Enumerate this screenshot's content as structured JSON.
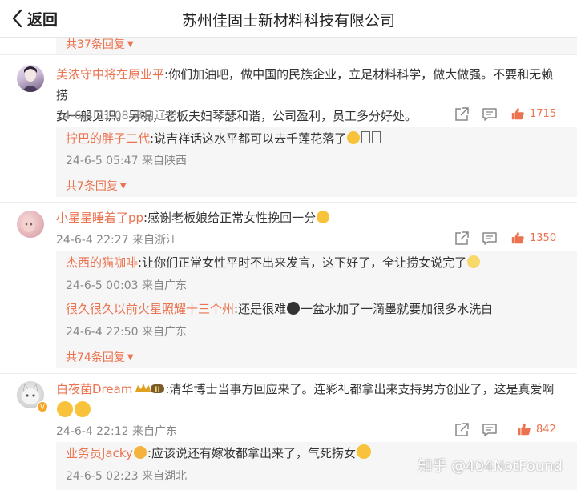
{
  "header": {
    "back_label": "返回",
    "title": "苏州佳固士新材料科技有限公司"
  },
  "top_more": "共37条回复",
  "comments": [
    {
      "user": "美浓守中将在原业平",
      "text1": ":你们加油吧，做中国的民族企业，立足材料科学，做大做强。不要和无赖捞",
      "text2": "女一般见识。另祝，老板夫妇琴瑟和谐，公司盈利，员工多分好处。",
      "time": "24-6-4 21:08",
      "location": "来自辽宁",
      "likes": "1715",
      "replies": [
        {
          "user": "拧巴的胖子二代",
          "text": ":说吉祥话这水平都可以去千莲花落了",
          "time": "24-6-5 05:47",
          "location": "来自陕西"
        }
      ],
      "more": "共7条回复"
    },
    {
      "user": "小星星睡着了pp",
      "text1": ":感谢老板娘给正常女性挽回一分",
      "time": "24-6-4 22:27",
      "location": "来自浙江",
      "likes": "1350",
      "replies": [
        {
          "user": "杰西的猫咖啡",
          "text": ":让你们正常女性平时不出来发言，这下好了，全让捞女说完了",
          "time": "24-6-5 00:03",
          "location": "来自广东"
        },
        {
          "user": "很久很久以前火星照耀十三个州",
          "text_a": ":还是很难",
          "text_b": "一盆水加了一滴墨就要加很多水洗白",
          "time": "24-6-4 22:50",
          "location": "来自广东"
        }
      ],
      "more": "共74条回复"
    },
    {
      "user": "白夜菌Dream",
      "badge": "II",
      "text1": ":清华博士当事方回应来了。连彩礼都拿出来支持男方创业了，这是真爱啊",
      "time": "24-6-4 22:12",
      "location": "来自广东",
      "likes": "842",
      "replies": [
        {
          "user": "业务员Jacky",
          "text": ":应该说还有嫁妆都拿出来了，气死捞女",
          "time": "24-6-5 02:23",
          "location": "来自湖北"
        }
      ]
    }
  ],
  "watermark": "知乎 @404NotFound",
  "icons": {
    "back": "chevron-left-icon",
    "share": "share-icon",
    "comment": "comment-icon",
    "like": "thumbs-up-icon"
  },
  "colors": {
    "accent": "#eb7350",
    "meta": "#888888",
    "reply_bg": "#f6f6f6"
  }
}
